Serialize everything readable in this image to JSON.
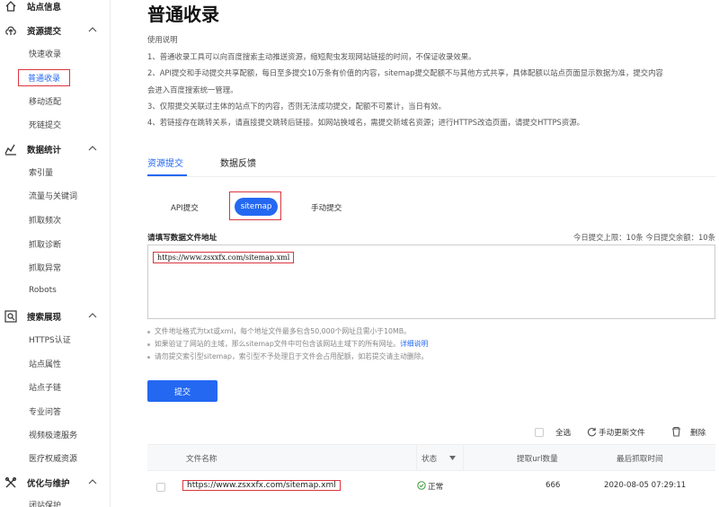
{
  "sidebar": {
    "groups": [
      {
        "label": "站点信息",
        "icon": "home-icon"
      },
      {
        "label": "资源提交",
        "icon": "upload-icon",
        "items": [
          "快速收录",
          "普通收录",
          "移动适配",
          "死链提交"
        ],
        "active": "普通收录"
      },
      {
        "label": "数据统计",
        "icon": "chart-icon",
        "items": [
          "索引量",
          "流量与关键词",
          "抓取频次",
          "抓取诊断",
          "抓取异常",
          "Robots"
        ]
      },
      {
        "label": "搜索展现",
        "icon": "search-icon",
        "items": [
          "HTTPS认证",
          "站点属性",
          "站点子链",
          "专业问答",
          "视频极速服务",
          "医疗权威资源"
        ]
      },
      {
        "label": "优化与维护",
        "icon": "tools-icon",
        "items": [
          "闭站保护"
        ]
      }
    ]
  },
  "main": {
    "title": "普通收录",
    "usage_heading": "使用说明",
    "usage_lines": [
      "1、普通收录工具可以向百度搜索主动推送资源，缩短爬虫发现网站链接的时间，不保证收录效果。",
      "2、API提交和手动提交共享配额，每日至多提交10万条有价值的内容，sitemap提交配额不与其他方式共享，具体配额以站点页面显示数据为准，提交内容",
      "会进入百度搜索统一管理。",
      "3、仅限提交关联过主体的站点下的内容，否则无法成功提交，配额不可累计，当日有效。",
      "4、若链接存在跳转关系，请直接提交跳转后链接。如网站换域名，需提交新域名资源；进行HTTPS改造页面，请提交HTTPS资源。"
    ],
    "tabs": [
      "资源提交",
      "数据反馈"
    ],
    "subtabs": [
      "API提交",
      "sitemap",
      "手动提交"
    ],
    "form_label": "请填写数据文件地址",
    "quota_text": "今日提交上限：10条   今日提交余额：10条",
    "textarea_value": "https://www.zsxxfx.com/sitemap.xml",
    "notes": [
      "文件地址格式为txt或xml，每个地址文件最多包含50,000个网址且需小于10MB。",
      "如果验证了网站的主域，那么sitemap文件中可包含该网站主域下的所有网址。",
      "请勿提交索引型sitemap，索引型不予处理且于文件会占用配额，如若提交请主动删除。"
    ],
    "notes_link": "详细说明",
    "submit_label": "提交",
    "toolbar": {
      "select_all": "全选",
      "manual_update": "手动更新文件",
      "delete": "删除"
    },
    "table": {
      "columns": [
        "文件名称",
        "状态",
        "提取url数量",
        "最后抓取时间"
      ],
      "rows": [
        {
          "file": "https://www.zsxxfx.com/sitemap.xml",
          "status": "正常",
          "count": "666",
          "time": "2020-08-05 07:29:11"
        }
      ]
    }
  },
  "colors": {
    "accent": "#2468f2",
    "highlight_box": "#d9363e",
    "ok": "#3c9a3c"
  }
}
